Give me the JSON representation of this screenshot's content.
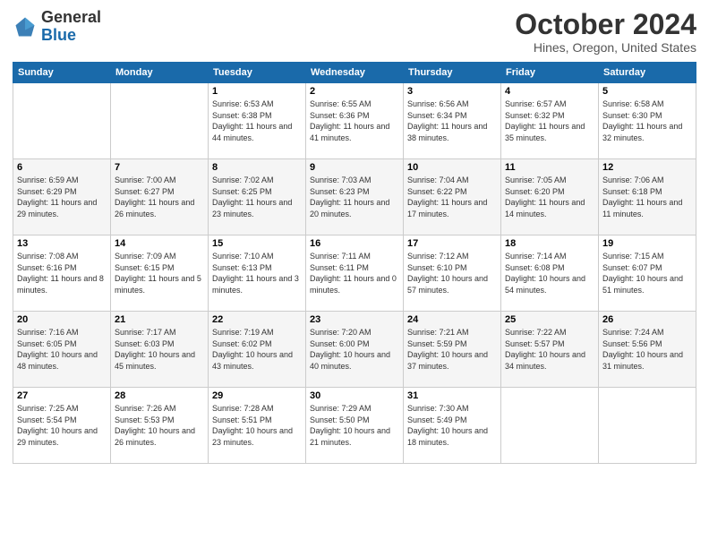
{
  "header": {
    "logo_general": "General",
    "logo_blue": "Blue",
    "month_title": "October 2024",
    "location": "Hines, Oregon, United States"
  },
  "days_of_week": [
    "Sunday",
    "Monday",
    "Tuesday",
    "Wednesday",
    "Thursday",
    "Friday",
    "Saturday"
  ],
  "weeks": [
    [
      {
        "num": "",
        "sunrise": "",
        "sunset": "",
        "daylight": ""
      },
      {
        "num": "",
        "sunrise": "",
        "sunset": "",
        "daylight": ""
      },
      {
        "num": "1",
        "sunrise": "Sunrise: 6:53 AM",
        "sunset": "Sunset: 6:38 PM",
        "daylight": "Daylight: 11 hours and 44 minutes."
      },
      {
        "num": "2",
        "sunrise": "Sunrise: 6:55 AM",
        "sunset": "Sunset: 6:36 PM",
        "daylight": "Daylight: 11 hours and 41 minutes."
      },
      {
        "num": "3",
        "sunrise": "Sunrise: 6:56 AM",
        "sunset": "Sunset: 6:34 PM",
        "daylight": "Daylight: 11 hours and 38 minutes."
      },
      {
        "num": "4",
        "sunrise": "Sunrise: 6:57 AM",
        "sunset": "Sunset: 6:32 PM",
        "daylight": "Daylight: 11 hours and 35 minutes."
      },
      {
        "num": "5",
        "sunrise": "Sunrise: 6:58 AM",
        "sunset": "Sunset: 6:30 PM",
        "daylight": "Daylight: 11 hours and 32 minutes."
      }
    ],
    [
      {
        "num": "6",
        "sunrise": "Sunrise: 6:59 AM",
        "sunset": "Sunset: 6:29 PM",
        "daylight": "Daylight: 11 hours and 29 minutes."
      },
      {
        "num": "7",
        "sunrise": "Sunrise: 7:00 AM",
        "sunset": "Sunset: 6:27 PM",
        "daylight": "Daylight: 11 hours and 26 minutes."
      },
      {
        "num": "8",
        "sunrise": "Sunrise: 7:02 AM",
        "sunset": "Sunset: 6:25 PM",
        "daylight": "Daylight: 11 hours and 23 minutes."
      },
      {
        "num": "9",
        "sunrise": "Sunrise: 7:03 AM",
        "sunset": "Sunset: 6:23 PM",
        "daylight": "Daylight: 11 hours and 20 minutes."
      },
      {
        "num": "10",
        "sunrise": "Sunrise: 7:04 AM",
        "sunset": "Sunset: 6:22 PM",
        "daylight": "Daylight: 11 hours and 17 minutes."
      },
      {
        "num": "11",
        "sunrise": "Sunrise: 7:05 AM",
        "sunset": "Sunset: 6:20 PM",
        "daylight": "Daylight: 11 hours and 14 minutes."
      },
      {
        "num": "12",
        "sunrise": "Sunrise: 7:06 AM",
        "sunset": "Sunset: 6:18 PM",
        "daylight": "Daylight: 11 hours and 11 minutes."
      }
    ],
    [
      {
        "num": "13",
        "sunrise": "Sunrise: 7:08 AM",
        "sunset": "Sunset: 6:16 PM",
        "daylight": "Daylight: 11 hours and 8 minutes."
      },
      {
        "num": "14",
        "sunrise": "Sunrise: 7:09 AM",
        "sunset": "Sunset: 6:15 PM",
        "daylight": "Daylight: 11 hours and 5 minutes."
      },
      {
        "num": "15",
        "sunrise": "Sunrise: 7:10 AM",
        "sunset": "Sunset: 6:13 PM",
        "daylight": "Daylight: 11 hours and 3 minutes."
      },
      {
        "num": "16",
        "sunrise": "Sunrise: 7:11 AM",
        "sunset": "Sunset: 6:11 PM",
        "daylight": "Daylight: 11 hours and 0 minutes."
      },
      {
        "num": "17",
        "sunrise": "Sunrise: 7:12 AM",
        "sunset": "Sunset: 6:10 PM",
        "daylight": "Daylight: 10 hours and 57 minutes."
      },
      {
        "num": "18",
        "sunrise": "Sunrise: 7:14 AM",
        "sunset": "Sunset: 6:08 PM",
        "daylight": "Daylight: 10 hours and 54 minutes."
      },
      {
        "num": "19",
        "sunrise": "Sunrise: 7:15 AM",
        "sunset": "Sunset: 6:07 PM",
        "daylight": "Daylight: 10 hours and 51 minutes."
      }
    ],
    [
      {
        "num": "20",
        "sunrise": "Sunrise: 7:16 AM",
        "sunset": "Sunset: 6:05 PM",
        "daylight": "Daylight: 10 hours and 48 minutes."
      },
      {
        "num": "21",
        "sunrise": "Sunrise: 7:17 AM",
        "sunset": "Sunset: 6:03 PM",
        "daylight": "Daylight: 10 hours and 45 minutes."
      },
      {
        "num": "22",
        "sunrise": "Sunrise: 7:19 AM",
        "sunset": "Sunset: 6:02 PM",
        "daylight": "Daylight: 10 hours and 43 minutes."
      },
      {
        "num": "23",
        "sunrise": "Sunrise: 7:20 AM",
        "sunset": "Sunset: 6:00 PM",
        "daylight": "Daylight: 10 hours and 40 minutes."
      },
      {
        "num": "24",
        "sunrise": "Sunrise: 7:21 AM",
        "sunset": "Sunset: 5:59 PM",
        "daylight": "Daylight: 10 hours and 37 minutes."
      },
      {
        "num": "25",
        "sunrise": "Sunrise: 7:22 AM",
        "sunset": "Sunset: 5:57 PM",
        "daylight": "Daylight: 10 hours and 34 minutes."
      },
      {
        "num": "26",
        "sunrise": "Sunrise: 7:24 AM",
        "sunset": "Sunset: 5:56 PM",
        "daylight": "Daylight: 10 hours and 31 minutes."
      }
    ],
    [
      {
        "num": "27",
        "sunrise": "Sunrise: 7:25 AM",
        "sunset": "Sunset: 5:54 PM",
        "daylight": "Daylight: 10 hours and 29 minutes."
      },
      {
        "num": "28",
        "sunrise": "Sunrise: 7:26 AM",
        "sunset": "Sunset: 5:53 PM",
        "daylight": "Daylight: 10 hours and 26 minutes."
      },
      {
        "num": "29",
        "sunrise": "Sunrise: 7:28 AM",
        "sunset": "Sunset: 5:51 PM",
        "daylight": "Daylight: 10 hours and 23 minutes."
      },
      {
        "num": "30",
        "sunrise": "Sunrise: 7:29 AM",
        "sunset": "Sunset: 5:50 PM",
        "daylight": "Daylight: 10 hours and 21 minutes."
      },
      {
        "num": "31",
        "sunrise": "Sunrise: 7:30 AM",
        "sunset": "Sunset: 5:49 PM",
        "daylight": "Daylight: 10 hours and 18 minutes."
      },
      {
        "num": "",
        "sunrise": "",
        "sunset": "",
        "daylight": ""
      },
      {
        "num": "",
        "sunrise": "",
        "sunset": "",
        "daylight": ""
      }
    ]
  ]
}
